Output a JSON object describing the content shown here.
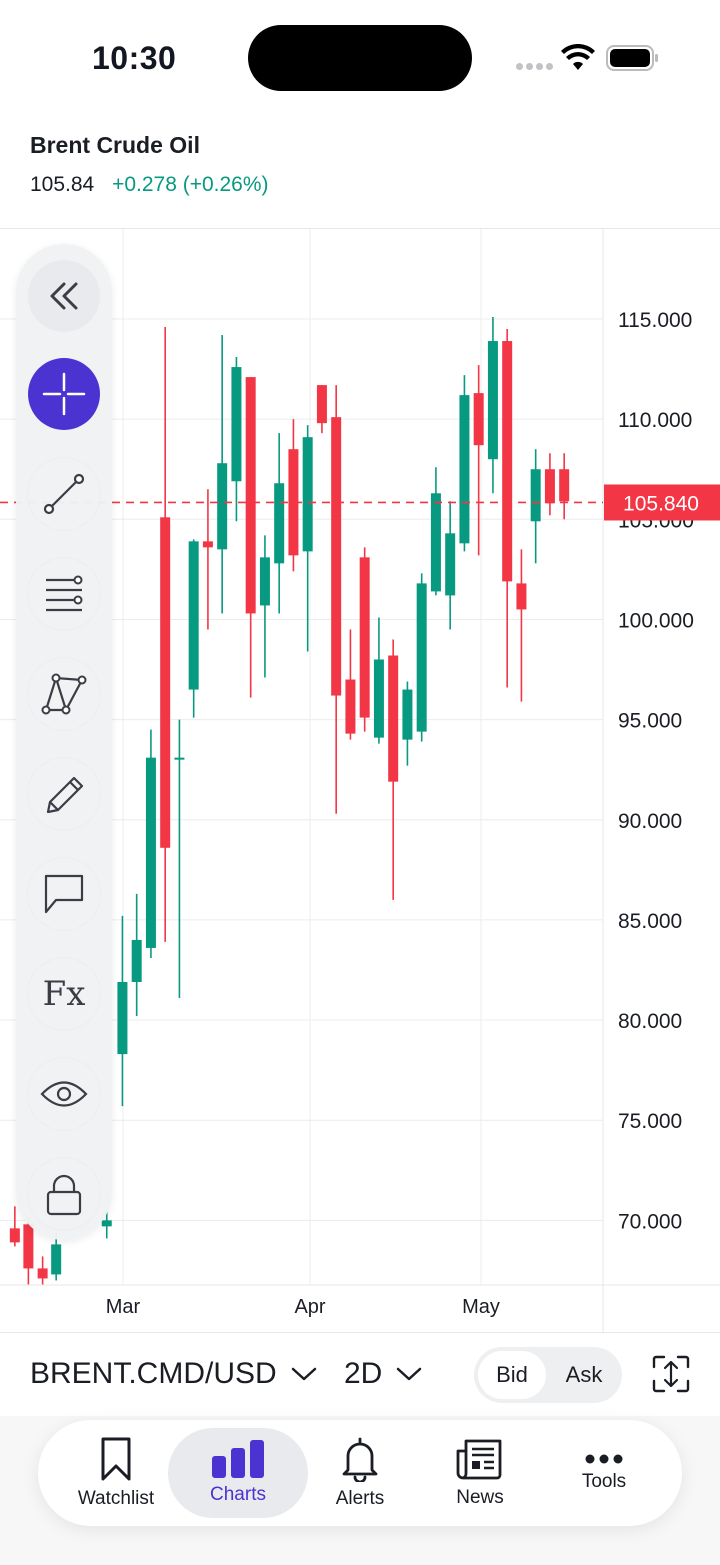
{
  "status_bar": {
    "time": "10:30"
  },
  "header": {
    "symbol_name": "Brent Crude Oil",
    "last_price": "105.84",
    "change": "+0.278 (+0.26%)"
  },
  "colors": {
    "up": "#089981",
    "down": "#f23645",
    "accent": "#4b33d1"
  },
  "drawing_tools": [
    {
      "icon": "collapse-icon"
    },
    {
      "icon": "crosshair-icon",
      "active": true
    },
    {
      "icon": "trend-line-icon"
    },
    {
      "icon": "fib-levels-icon"
    },
    {
      "icon": "pattern-icon"
    },
    {
      "icon": "brush-icon"
    },
    {
      "icon": "annotation-icon"
    },
    {
      "icon": "fx-icon",
      "label": "Fx"
    },
    {
      "icon": "eye-icon"
    },
    {
      "icon": "lock-icon"
    }
  ],
  "chart_data": {
    "type": "candlestick",
    "y_ticks": [
      "115.000",
      "110.000",
      "105.000",
      "100.000",
      "95.000",
      "90.000",
      "85.000",
      "80.000",
      "75.000",
      "70.000"
    ],
    "x_ticks": [
      "Mar",
      "Apr",
      "May"
    ],
    "ylim": [
      67,
      120
    ],
    "last_price_label": "105.840",
    "last_price": 105.84,
    "grid": true,
    "candles": [
      {
        "x": 0.55,
        "o": 69.6,
        "h": 70.7,
        "l": 68.7,
        "c": 68.9
      },
      {
        "x": 1.5,
        "o": 69.8,
        "h": 70.1,
        "l": 66.8,
        "c": 67.6
      },
      {
        "x": 2.5,
        "o": 67.6,
        "h": 68.2,
        "l": 66.8,
        "c": 67.1
      },
      {
        "x": 3.45,
        "o": 67.3,
        "h": 69.4,
        "l": 67.0,
        "c": 68.8
      },
      {
        "x": 7.0,
        "o": 69.7,
        "h": 70.5,
        "l": 69.1,
        "c": 70.0
      },
      {
        "x": 8.1,
        "o": 78.3,
        "h": 85.2,
        "l": 75.7,
        "c": 81.9
      },
      {
        "x": 9.1,
        "o": 81.9,
        "h": 86.3,
        "l": 80.2,
        "c": 84.0
      },
      {
        "x": 10.1,
        "o": 83.6,
        "h": 94.5,
        "l": 83.1,
        "c": 93.1
      },
      {
        "x": 11.1,
        "o": 105.1,
        "h": 114.6,
        "l": 83.9,
        "c": 88.6
      },
      {
        "x": 12.1,
        "o": 93.0,
        "h": 95.0,
        "l": 81.1,
        "c": 93.1
      },
      {
        "x": 13.1,
        "o": 96.5,
        "h": 104.0,
        "l": 95.1,
        "c": 103.9
      },
      {
        "x": 14.1,
        "o": 103.9,
        "h": 106.5,
        "l": 99.5,
        "c": 103.6
      },
      {
        "x": 15.1,
        "o": 103.5,
        "h": 114.2,
        "l": 100.3,
        "c": 107.8
      },
      {
        "x": 16.1,
        "o": 106.9,
        "h": 113.1,
        "l": 104.9,
        "c": 112.6
      },
      {
        "x": 17.1,
        "o": 112.1,
        "h": 109.9,
        "l": 96.1,
        "c": 100.3
      },
      {
        "x": 18.1,
        "o": 100.7,
        "h": 104.2,
        "l": 97.1,
        "c": 103.1
      },
      {
        "x": 19.1,
        "o": 102.8,
        "h": 109.3,
        "l": 100.3,
        "c": 106.8
      },
      {
        "x": 20.1,
        "o": 108.5,
        "h": 110.0,
        "l": 102.4,
        "c": 103.2
      },
      {
        "x": 21.1,
        "o": 103.4,
        "h": 109.7,
        "l": 98.4,
        "c": 109.1
      },
      {
        "x": 22.1,
        "o": 111.7,
        "h": 111.7,
        "l": 109.3,
        "c": 109.8
      },
      {
        "x": 23.1,
        "o": 110.1,
        "h": 111.7,
        "l": 90.3,
        "c": 96.2
      },
      {
        "x": 24.1,
        "o": 97.0,
        "h": 99.5,
        "l": 94.0,
        "c": 94.3
      },
      {
        "x": 25.1,
        "o": 103.1,
        "h": 103.6,
        "l": 94.4,
        "c": 95.1
      },
      {
        "x": 26.1,
        "o": 94.1,
        "h": 100.1,
        "l": 93.8,
        "c": 98.0
      },
      {
        "x": 27.1,
        "o": 98.2,
        "h": 99.0,
        "l": 86.0,
        "c": 91.9
      },
      {
        "x": 28.1,
        "o": 94.0,
        "h": 96.9,
        "l": 92.7,
        "c": 96.5
      },
      {
        "x": 29.1,
        "o": 94.4,
        "h": 102.3,
        "l": 93.9,
        "c": 101.8
      },
      {
        "x": 30.1,
        "o": 101.4,
        "h": 107.6,
        "l": 101.2,
        "c": 106.3
      },
      {
        "x": 31.1,
        "o": 101.2,
        "h": 105.9,
        "l": 99.5,
        "c": 104.3
      },
      {
        "x": 32.1,
        "o": 103.8,
        "h": 112.2,
        "l": 103.4,
        "c": 111.2
      },
      {
        "x": 33.1,
        "o": 111.3,
        "h": 112.7,
        "l": 103.2,
        "c": 108.7
      },
      {
        "x": 34.1,
        "o": 108.0,
        "h": 115.1,
        "l": 106.3,
        "c": 113.9
      },
      {
        "x": 35.1,
        "o": 113.9,
        "h": 114.5,
        "l": 96.6,
        "c": 101.9
      },
      {
        "x": 36.1,
        "o": 101.8,
        "h": 103.5,
        "l": 95.9,
        "c": 100.5
      },
      {
        "x": 37.1,
        "o": 104.9,
        "h": 108.5,
        "l": 102.8,
        "c": 107.5
      },
      {
        "x": 38.1,
        "o": 107.5,
        "h": 108.3,
        "l": 105.2,
        "c": 105.8
      },
      {
        "x": 39.1,
        "o": 107.5,
        "h": 108.3,
        "l": 105.0,
        "c": 105.9
      }
    ]
  },
  "bottom_bar": {
    "symbol": "BRENT.CMD/USD",
    "timeframe": "2D",
    "bid_label": "Bid",
    "ask_label": "Ask"
  },
  "nav": [
    {
      "label": "Watchlist",
      "icon": "bookmark-icon"
    },
    {
      "label": "Charts",
      "icon": "bar-chart-icon",
      "active": true
    },
    {
      "label": "Alerts",
      "icon": "bell-icon"
    },
    {
      "label": "News",
      "icon": "newspaper-icon"
    },
    {
      "label": "Tools",
      "icon": "more-icon"
    }
  ]
}
